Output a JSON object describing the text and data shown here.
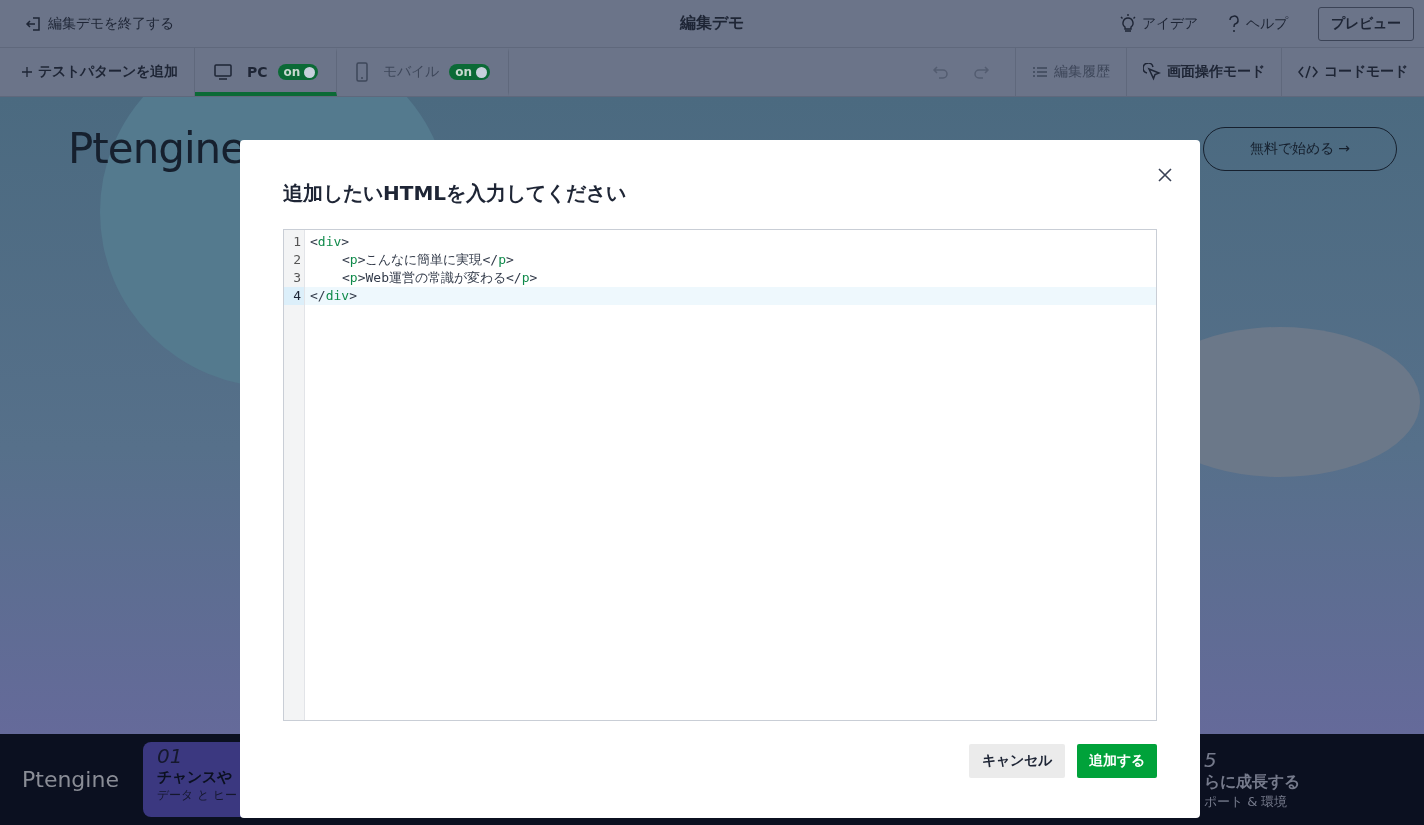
{
  "header": {
    "exit_label": "編集デモを終了する",
    "title": "編集デモ",
    "idea_label": "アイデア",
    "help_label": "ヘルプ",
    "preview_button": "プレビュー"
  },
  "toolbar": {
    "add_pattern": "テストパターンを追加",
    "device_tabs": [
      {
        "kind": "pc",
        "label": "PC",
        "selected": true,
        "toggle": {
          "label": "on",
          "on": true
        }
      },
      {
        "kind": "mobile",
        "label": "モバイル",
        "selected": false,
        "toggle": {
          "label": "on",
          "on": true
        }
      }
    ],
    "undo_disabled": true,
    "redo_disabled": true,
    "history": {
      "label": "編集履歴",
      "disabled": true
    },
    "screen_mode": "画面操作モード",
    "code_mode": "コードモード"
  },
  "site": {
    "logo": "Ptengine",
    "cta_button": "無料で始める →"
  },
  "footer": {
    "logo": "Ptengine",
    "card": {
      "number": "01",
      "title": "チャンスや",
      "subtitle": "データ と ヒー"
    },
    "right": {
      "number": "5",
      "title": "らに成長する",
      "subtitle": "ポート & 環境"
    }
  },
  "dialog": {
    "title": "追加したいHTMLを入力してください",
    "code_lines": [
      {
        "number": "1",
        "indented": false,
        "selected": false,
        "tokens": [
          {
            "kind": "punct",
            "text": "<"
          },
          {
            "kind": "tag",
            "text": "div"
          },
          {
            "kind": "punct",
            "text": ">"
          }
        ]
      },
      {
        "number": "2",
        "indented": true,
        "selected": false,
        "tokens": [
          {
            "kind": "punct",
            "text": "<"
          },
          {
            "kind": "tag",
            "text": "p"
          },
          {
            "kind": "punct",
            "text": ">"
          },
          {
            "kind": "text",
            "text": "こんなに簡単に実現"
          },
          {
            "kind": "punct",
            "text": "</"
          },
          {
            "kind": "tag",
            "text": "p"
          },
          {
            "kind": "punct",
            "text": ">"
          }
        ]
      },
      {
        "number": "3",
        "indented": true,
        "selected": false,
        "tokens": [
          {
            "kind": "punct",
            "text": "<"
          },
          {
            "kind": "tag",
            "text": "p"
          },
          {
            "kind": "punct",
            "text": ">"
          },
          {
            "kind": "text",
            "text": "Web運営の常識が変わる"
          },
          {
            "kind": "punct",
            "text": "</"
          },
          {
            "kind": "tag",
            "text": "p"
          },
          {
            "kind": "punct",
            "text": ">"
          }
        ]
      },
      {
        "number": "4",
        "indented": false,
        "selected": true,
        "tokens": [
          {
            "kind": "punct",
            "text": "</"
          },
          {
            "kind": "tag",
            "text": "div"
          },
          {
            "kind": "punct",
            "text": ">"
          }
        ]
      }
    ],
    "cancel_button": "キャンセル",
    "confirm_button": "追加する"
  }
}
